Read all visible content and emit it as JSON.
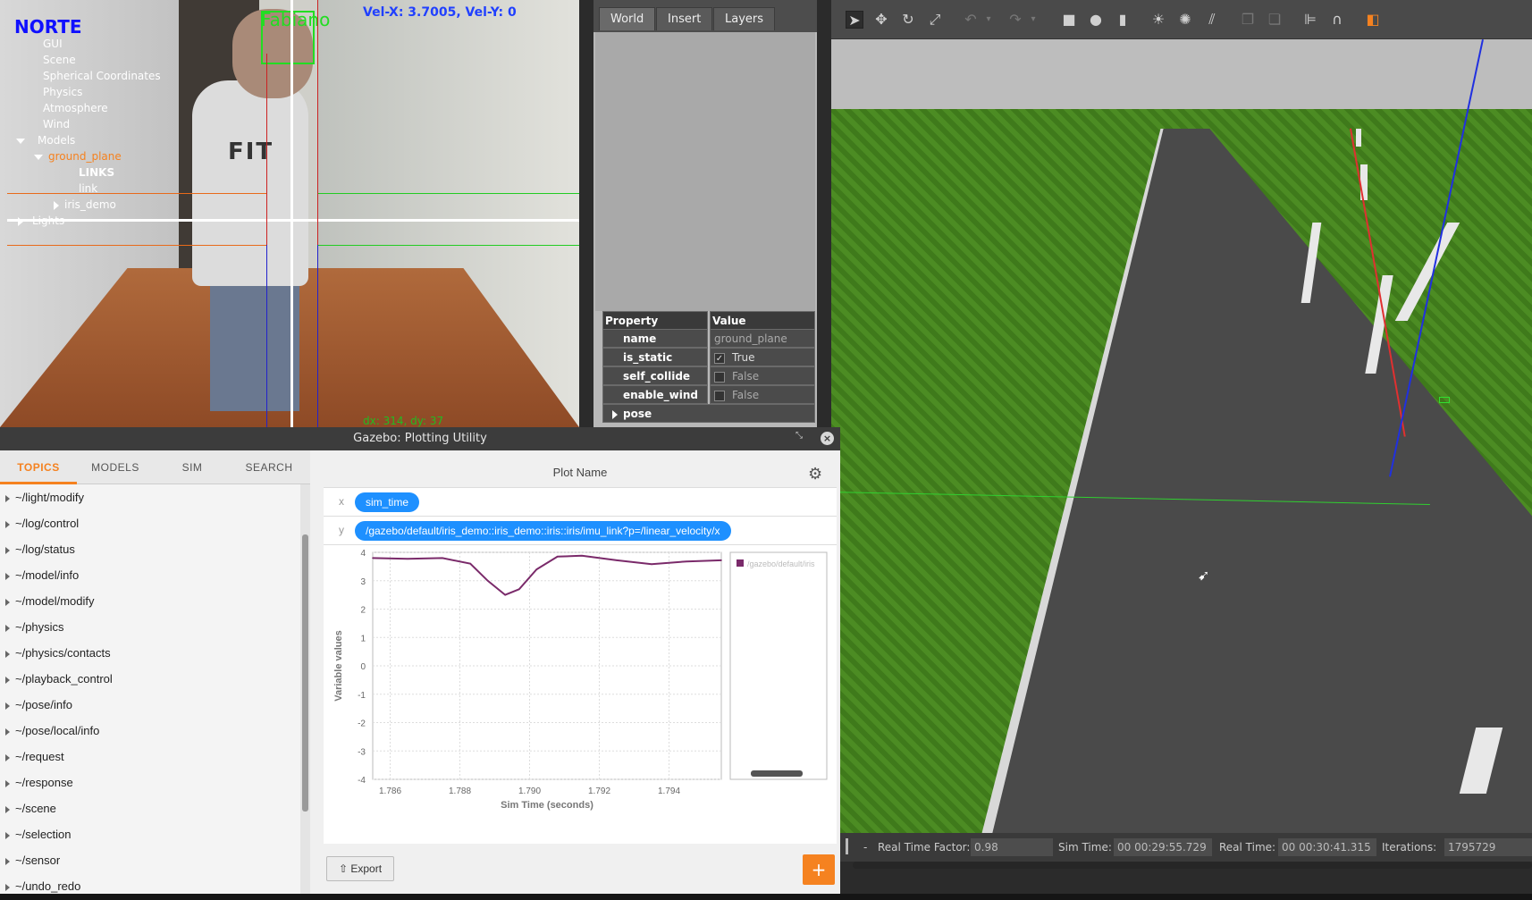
{
  "camera": {
    "overlay_north": "NORTE",
    "face_label": "Fabiano",
    "velocity": "Vel-X: 3.7005, Vel-Y: 0",
    "offset": "dx: 314, dy: 37",
    "shirt_print": "FIT",
    "colors": {
      "north": "#1010ff",
      "face": "#22dd22",
      "velocity": "#2040ff",
      "offset": "#22bb22"
    }
  },
  "world_panel": {
    "tabs": [
      "World",
      "Insert",
      "Layers"
    ],
    "tree": [
      {
        "label": "GUI"
      },
      {
        "label": "Scene"
      },
      {
        "label": "Spherical Coordinates"
      },
      {
        "label": "Physics"
      },
      {
        "label": "Atmosphere"
      },
      {
        "label": "Wind"
      },
      {
        "label": "Models"
      },
      {
        "label": "ground_plane"
      },
      {
        "label": "LINKS"
      },
      {
        "label": "link"
      },
      {
        "label": "iris_demo"
      },
      {
        "label": "Lights"
      }
    ],
    "properties": {
      "header_key": "Property",
      "header_value": "Value",
      "rows": [
        {
          "key": "name",
          "value": "ground_plane"
        },
        {
          "key": "is_static",
          "value": "True",
          "checked": "✓"
        },
        {
          "key": "self_collide",
          "value": "False"
        },
        {
          "key": "enable_wind",
          "value": "False"
        },
        {
          "key": "pose",
          "value": ""
        }
      ]
    }
  },
  "toolbar": {
    "icons": [
      "select-arrow-icon",
      "translate-icon",
      "rotate-icon",
      "scale-icon",
      "undo-icon",
      "redo-icon",
      "box-icon",
      "sphere-icon",
      "cylinder-icon",
      "sun-light-icon",
      "point-light-icon",
      "spot-light-icon",
      "copy-icon",
      "paste-icon",
      "align-icon",
      "snap-icon",
      "color-cube-icon"
    ]
  },
  "statusbar": {
    "rtf_label": "Real Time Factor:",
    "rtf_value": "0.98",
    "sim_label": "Sim Time:",
    "sim_value": "00 00:29:55.729",
    "real_label": "Real Time:",
    "real_value": "00 00:30:41.315",
    "iter_label": "Iterations:",
    "iter_value": "1795729",
    "dash": "-"
  },
  "plot_window": {
    "title": "Gazebo: Plotting Utility",
    "close": "×",
    "tabs": [
      "TOPICS",
      "MODELS",
      "SIM",
      "SEARCH"
    ],
    "topics": [
      "~/light/modify",
      "~/log/control",
      "~/log/status",
      "~/model/info",
      "~/model/modify",
      "~/physics",
      "~/physics/contacts",
      "~/playback_control",
      "~/pose/info",
      "~/pose/local/info",
      "~/request",
      "~/response",
      "~/scene",
      "~/selection",
      "~/sensor",
      "~/undo_redo"
    ],
    "plot_name": "Plot Name",
    "x_label": "x",
    "x_value": "sim_time",
    "y_label": "y",
    "y_value": "/gazebo/default/iris_demo::iris_demo::iris::iris/imu_link?p=/linear_velocity/x",
    "export_label": "Export",
    "add_label": "+",
    "accent": "#f58220",
    "pill_color": "#1e90ff"
  },
  "chart_data": {
    "type": "line",
    "xlabel": "Sim Time (seconds)",
    "ylabel": "Variable values",
    "xlim": [
      1.7855,
      1.7955
    ],
    "ylim": [
      -4,
      4
    ],
    "x_ticks": [
      "1.786",
      "1.788",
      "1.790",
      "1.792",
      "1.794"
    ],
    "y_ticks": [
      "4",
      "3",
      "2",
      "1",
      "0",
      "-1",
      "-2",
      "-3",
      "-4"
    ],
    "legend": "/gazebo/default/iris",
    "line_color": "#7a2a6a",
    "series": [
      {
        "x": [
          1.7855,
          1.7865,
          1.7875,
          1.7883,
          1.7888,
          1.7893,
          1.7897,
          1.7902,
          1.7908,
          1.7915,
          1.7925,
          1.7935,
          1.7945,
          1.7955
        ],
        "y": [
          3.8,
          3.77,
          3.8,
          3.6,
          3.0,
          2.5,
          2.7,
          3.4,
          3.85,
          3.88,
          3.72,
          3.58,
          3.68,
          3.72
        ]
      }
    ]
  }
}
